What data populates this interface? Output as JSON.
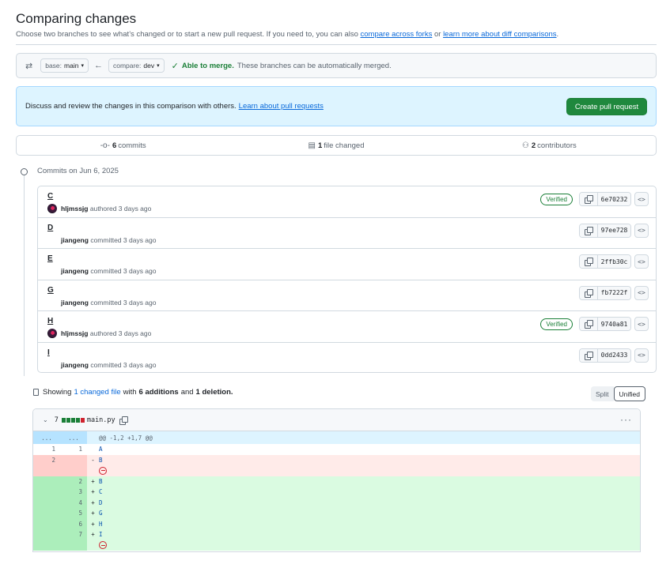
{
  "header": {
    "title": "Comparing changes",
    "subtitle_pre": "Choose two branches to see what’s changed or to start a new pull request. If you need to, you can also",
    "link_forks": "compare across forks",
    "subtitle_mid": "or",
    "link_learn": "learn more about diff comparisons",
    "subtitle_end": "."
  },
  "range": {
    "base_label": "base:",
    "base_value": "main",
    "compare_label": "compare:",
    "compare_value": "dev",
    "merge_status": "Able to merge.",
    "merge_detail": "These branches can be automatically merged."
  },
  "discuss": {
    "text": "Discuss and review the changes in this comparison with others.",
    "link": "Learn about pull requests",
    "button": "Create pull request"
  },
  "summary": {
    "commits_count": "6",
    "commits_label": "commits",
    "files_count": "1",
    "files_label": "file changed",
    "contributors_count": "2",
    "contributors_label": "contributors"
  },
  "timeline": {
    "heading": "Commits on Jun 6, 2025"
  },
  "commits": [
    {
      "title": "C",
      "author": "hljmssjg",
      "action": "authored 3 days ago",
      "verified": "Verified",
      "sha": "6e70232",
      "avatar": true
    },
    {
      "title": "D",
      "author": "jiangeng",
      "action": "committed 3 days ago",
      "verified": "",
      "sha": "97ee728",
      "avatar": false
    },
    {
      "title": "E",
      "author": "jiangeng",
      "action": "committed 3 days ago",
      "verified": "",
      "sha": "2ffb30c",
      "avatar": false
    },
    {
      "title": "G",
      "author": "jiangeng",
      "action": "committed 3 days ago",
      "verified": "",
      "sha": "fb7222f",
      "avatar": false
    },
    {
      "title": "H",
      "author": "hljmssjg",
      "action": "authored 3 days ago",
      "verified": "Verified",
      "sha": "9740a81",
      "avatar": true
    },
    {
      "title": "I",
      "author": "jiangeng",
      "action": "committed 3 days ago",
      "verified": "",
      "sha": "0dd2433",
      "avatar": false
    }
  ],
  "diffstat": {
    "pre": "Showing",
    "files_link": "1 changed file",
    "with": "with",
    "additions": "6 additions",
    "and": "and",
    "deletions": "1 deletion.",
    "split": "Split",
    "unified": "Unified"
  },
  "file": {
    "count": "7",
    "name": "main.py",
    "more": "···",
    "hunk": {
      "left": "...",
      "right": "...",
      "text": "@@ -1,2 +1,7 @@"
    },
    "lines": [
      {
        "type": "ctx",
        "old": "1",
        "new": "1",
        "sign": "",
        "code": "A"
      },
      {
        "type": "del",
        "old": "2",
        "new": "",
        "sign": "-",
        "code": "B"
      },
      {
        "type": "del-nonl",
        "old": "",
        "new": "",
        "sign": "",
        "code": ""
      },
      {
        "type": "add",
        "old": "",
        "new": "2",
        "sign": "+",
        "code": "B"
      },
      {
        "type": "add",
        "old": "",
        "new": "3",
        "sign": "+",
        "code": "C"
      },
      {
        "type": "add",
        "old": "",
        "new": "4",
        "sign": "+",
        "code": "D"
      },
      {
        "type": "add",
        "old": "",
        "new": "5",
        "sign": "+",
        "code": "G"
      },
      {
        "type": "add",
        "old": "",
        "new": "6",
        "sign": "+",
        "code": "H"
      },
      {
        "type": "add",
        "old": "",
        "new": "7",
        "sign": "+",
        "code": "I"
      },
      {
        "type": "add-nonl",
        "old": "",
        "new": "",
        "sign": "",
        "code": ""
      }
    ]
  },
  "colors": {
    "accent": "#0969da",
    "success": "#1f883d",
    "danger": "#cf222e"
  }
}
